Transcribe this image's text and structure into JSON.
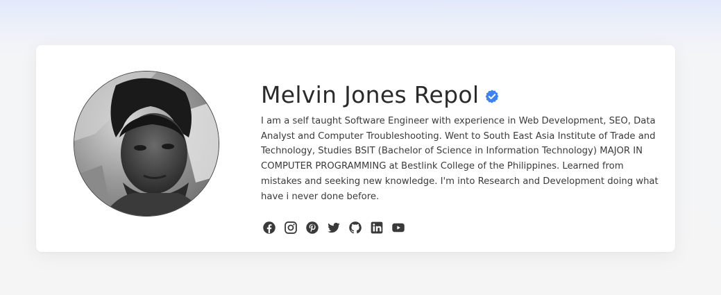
{
  "profile": {
    "name": "Melvin Jones Repol",
    "verified": true,
    "bio": "I am a self taught Software Engineer with experience in Web Development, SEO, Data Analyst and Computer Troubleshooting. Went to South East Asia Institute of Trade and Technology, Studies BSIT (Bachelor of Science in Information Technology) MAJOR IN COMPUTER PROGRAMMING at Bestlink College of the Philippines. Learned from mistakes and seeking new knowledge. I'm into Research and Development doing what have i never done before."
  },
  "social_icons": [
    "facebook-icon",
    "instagram-icon",
    "pinterest-icon",
    "twitter-icon",
    "github-icon",
    "linkedin-icon",
    "youtube-icon"
  ],
  "colors": {
    "verified_badge": "#3b82f6",
    "icon": "#3a3a3a",
    "text": "#2a2a2a",
    "card": "#ffffff"
  }
}
